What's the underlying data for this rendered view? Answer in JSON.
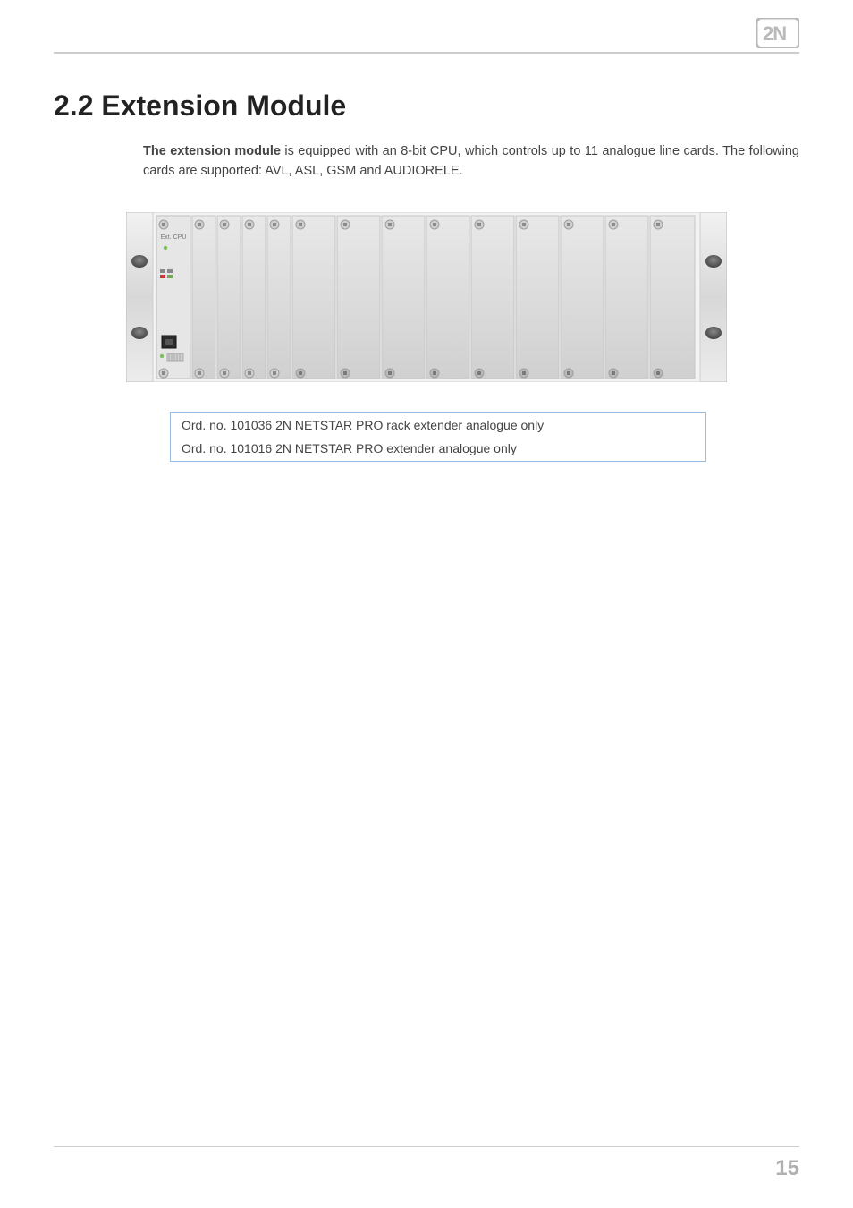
{
  "brand": {
    "logo_name": "2N"
  },
  "header": {
    "section_title": "2.2 Extension Module"
  },
  "body": {
    "p1_strong": "The extension module ",
    "p1_rest": "is equipped with an 8-bit CPU, which controls up to 11 analogue line cards. The following cards are supported: AVL, ASL, GSM and AUDIORELE."
  },
  "diagram": {
    "cpu_label": "Ext. CPU"
  },
  "orders": [
    "Ord. no. 101036 2N NETSTAR PRO rack extender analogue only",
    "Ord. no. 101016 2N NETSTAR PRO extender analogue only"
  ],
  "page_number": "15"
}
